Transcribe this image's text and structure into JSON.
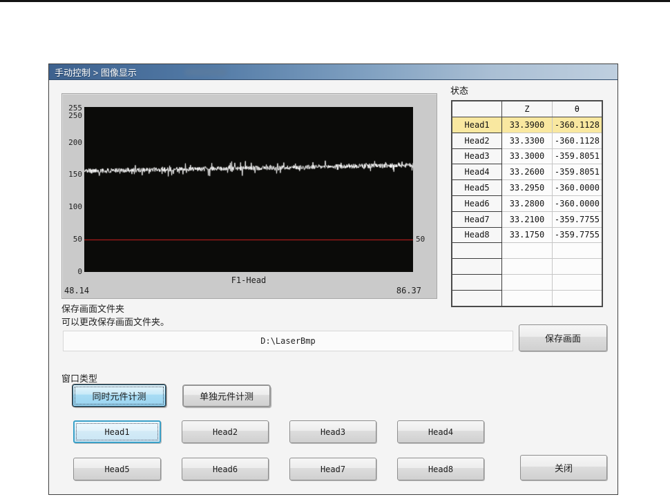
{
  "window": {
    "title": "手动控制 > 图像显示"
  },
  "status_panel": {
    "label": "状态",
    "table": {
      "columns": [
        "",
        "Z",
        "θ"
      ],
      "rows": [
        {
          "name": "Head1",
          "z": "33.3900",
          "theta": "-360.1128",
          "highlight": true
        },
        {
          "name": "Head2",
          "z": "33.3300",
          "theta": "-360.1128",
          "highlight": false
        },
        {
          "name": "Head3",
          "z": "33.3000",
          "theta": "-359.8051",
          "highlight": false
        },
        {
          "name": "Head4",
          "z": "33.2600",
          "theta": "-359.8051",
          "highlight": false
        },
        {
          "name": "Head5",
          "z": "33.2950",
          "theta": "-360.0000",
          "highlight": false
        },
        {
          "name": "Head6",
          "z": "33.2800",
          "theta": "-360.0000",
          "highlight": false
        },
        {
          "name": "Head7",
          "z": "33.2100",
          "theta": "-359.7755",
          "highlight": false
        },
        {
          "name": "Head8",
          "z": "33.1750",
          "theta": "-359.7755",
          "highlight": false
        }
      ],
      "empty_rows": 4,
      "highlight_color": "#f9e8a0"
    }
  },
  "chart_data": {
    "type": "line",
    "title": "F1-Head",
    "ylim": [
      0,
      255
    ],
    "yticks": [
      255,
      250,
      200,
      150,
      100,
      50,
      0
    ],
    "x_start_label": "48.14",
    "x_end_label": "86.37",
    "threshold": {
      "value": 50,
      "label": "50",
      "color": "#d42020"
    },
    "signal": {
      "name": "intensity-waveform",
      "baseline_start": 156,
      "baseline_end": 165,
      "noise_amplitude": 3.5,
      "spike_amplitude": 9,
      "points": 480,
      "color": "#ffffff"
    },
    "plot_bg": "#0b0b09",
    "grid": false,
    "legend": false
  },
  "save_section": {
    "heading": "保存画面文件夹",
    "description": "可以更改保存画面文件夹。",
    "path_value": "D:\\LaserBmp",
    "save_button": "保存画面"
  },
  "window_type": {
    "label": "窗口类型",
    "simultaneous_button": "同时元件计测",
    "individual_button": "单独元件计测"
  },
  "head_buttons": [
    "Head1",
    "Head2",
    "Head3",
    "Head4",
    "Head5",
    "Head6",
    "Head7",
    "Head8"
  ],
  "close_button": "关闭"
}
